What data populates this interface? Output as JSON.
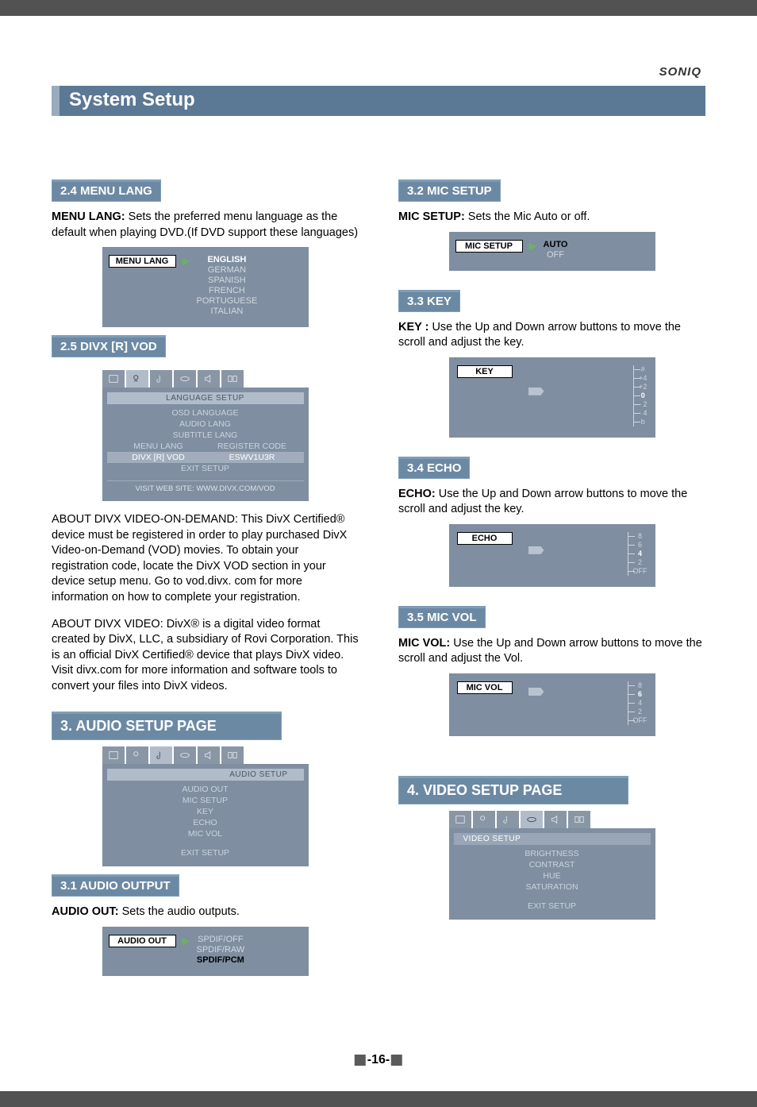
{
  "brand": "SONIQ",
  "title": "System Setup",
  "page_number": "-16-",
  "left": {
    "s24_head": "2.4  MENU LANG",
    "s24_lead": "MENU LANG:",
    "s24_text": "Sets the preferred menu language as the default when playing DVD.(If DVD support these languages)",
    "s24_box_label": "MENU LANG",
    "s24_opts": [
      "ENGLISH",
      "GERMAN",
      "SPANISH",
      "FRENCH",
      "PORTUGUESE",
      "ITALIAN"
    ],
    "s25_head": "2.5  DIVX [R] VOD",
    "s25_banner": "LANGUAGE SETUP",
    "s25_rows": [
      {
        "l": "OSD LANGUAGE",
        "r": ""
      },
      {
        "l": "AUDIO LANG",
        "r": ""
      },
      {
        "l": "SUBTITLE LANG",
        "r": ""
      },
      {
        "l": "MENU LANG",
        "r": "REGISTER CODE"
      },
      {
        "l": "DIVX [R] VOD",
        "r": "ESWV1U3R"
      },
      {
        "l": "EXIT SETUP",
        "r": ""
      }
    ],
    "s25_footer": "VISIT  WEB  SITE: WWW.DIVX.COM/VOD",
    "s25_para1": "ABOUT DIVX VIDEO-ON-DEMAND: This DivX Certified® device must be registered  in order to play purchased DivX Video-on-Demand (VOD) movies. To obtain your registration code, locate the DivX VOD section in your device setup menu. Go to vod.divx. com for more information on how  to complete your registration.",
    "s25_para2": "ABOUT DIVX VIDEO: DivX® is a digital video  format created by DivX, LLC, a subsidiary of Rovi Corporation. This is an official DivX Certified® device that plays DivX video. Visit divx.com for more information and software tools to convert your files into DivX videos.",
    "s3_head": "3.  AUDIO SETUP PAGE",
    "s3_banner": "AUDIO SETUP",
    "s3_rows": [
      "AUDIO OUT",
      "MIC SETUP",
      "KEY",
      "ECHO",
      "MIC VOL",
      "",
      "EXIT SETUP"
    ],
    "s31_head": "3.1  AUDIO OUTPUT",
    "s31_lead": "AUDIO OUT:",
    "s31_text": " Sets the audio outputs.",
    "s31_box_label": "AUDIO OUT",
    "s31_opts": [
      "SPDIF/OFF",
      "SPDIF/RAW",
      "SPDIF/PCM"
    ]
  },
  "right": {
    "s32_head": "3.2  MIC SETUP",
    "s32_lead": "MIC SETUP:",
    "s32_text": " Sets the Mic Auto or off.",
    "s32_box_label": "MIC SETUP",
    "s32_opts": [
      "AUTO",
      "OFF"
    ],
    "s33_head": "3.3  KEY",
    "s33_lead": "KEY :",
    "s33_text": " Use the Up and Down arrow buttons to move the scroll and adjust the key.",
    "s33_box_label": "KEY",
    "s33_scale": [
      "#",
      "+4",
      "+2",
      "0",
      "- 2",
      "- 4",
      "b"
    ],
    "s34_head": "3.4  ECHO",
    "s34_lead": "ECHO:",
    "s34_text": " Use the Up and Down arrow buttons to move the scroll and adjust the key.",
    "s34_box_label": "ECHO",
    "s34_scale": [
      "8",
      "6",
      "4",
      "2",
      "OFF"
    ],
    "s35_head": "3.5  MIC VOL",
    "s35_lead": "MIC VOL:",
    "s35_text": " Use the Up and Down arrow buttons to move the scroll and adjust the Vol.",
    "s35_box_label": "MIC VOL",
    "s35_scale": [
      "8",
      "6",
      "4",
      "2",
      "OFF"
    ],
    "s4_head": "4.  VIDEO SETUP PAGE",
    "s4_banner": "VIDEO SETUP",
    "s4_rows": [
      "BRIGHTNESS",
      "CONTRAST",
      "HUE",
      "SATURATION",
      "",
      "EXIT SETUP"
    ]
  }
}
